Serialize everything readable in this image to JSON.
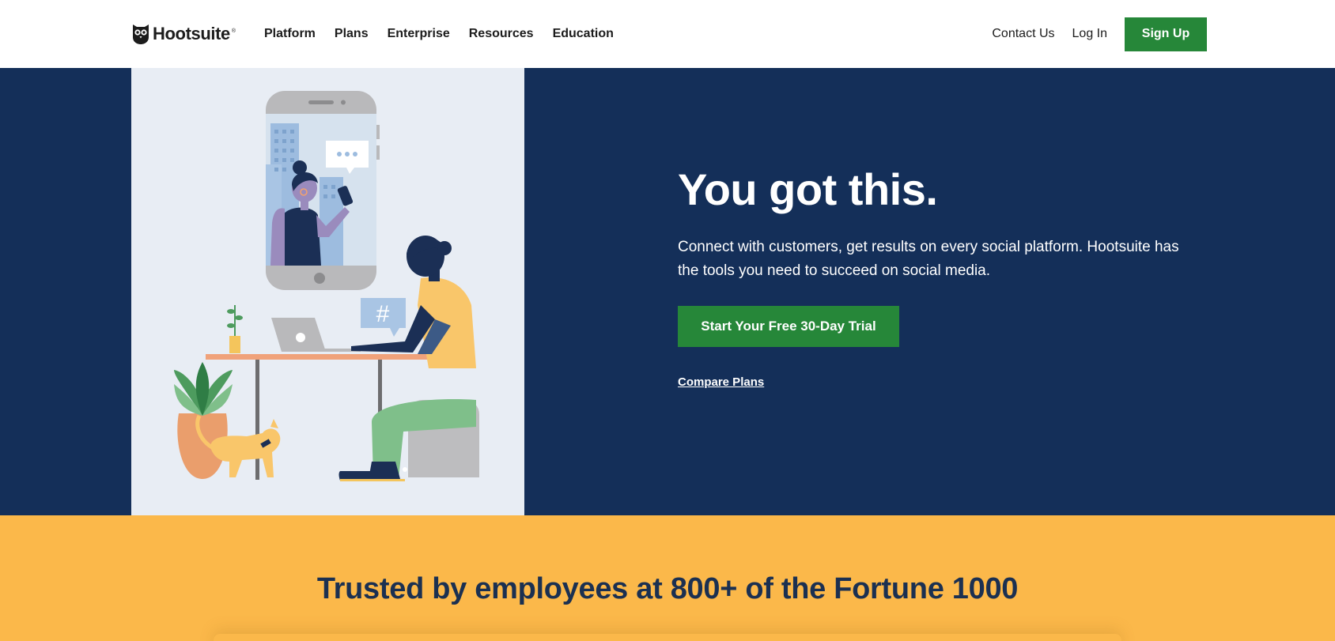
{
  "brand": {
    "name": "Hootsuite",
    "registered": "®"
  },
  "nav": {
    "items": [
      "Platform",
      "Plans",
      "Enterprise",
      "Resources",
      "Education"
    ]
  },
  "header_actions": {
    "contact_label": "Contact Us",
    "login_label": "Log In",
    "signup_label": "Sign Up"
  },
  "hero": {
    "title": "You got this.",
    "description": "Connect with customers, get results on every social platform. Hootsuite has the tools you need to succeed on social media.",
    "cta_label": "Start Your Free 30-Day Trial",
    "compare_label": "Compare Plans"
  },
  "trusted": {
    "title": "Trusted by employees at 800+ of the Fortune 1000"
  },
  "colors": {
    "navy": "#142f59",
    "green": "#268739",
    "yellow": "#fbb84a",
    "illustration_bg": "#e8edf4"
  }
}
